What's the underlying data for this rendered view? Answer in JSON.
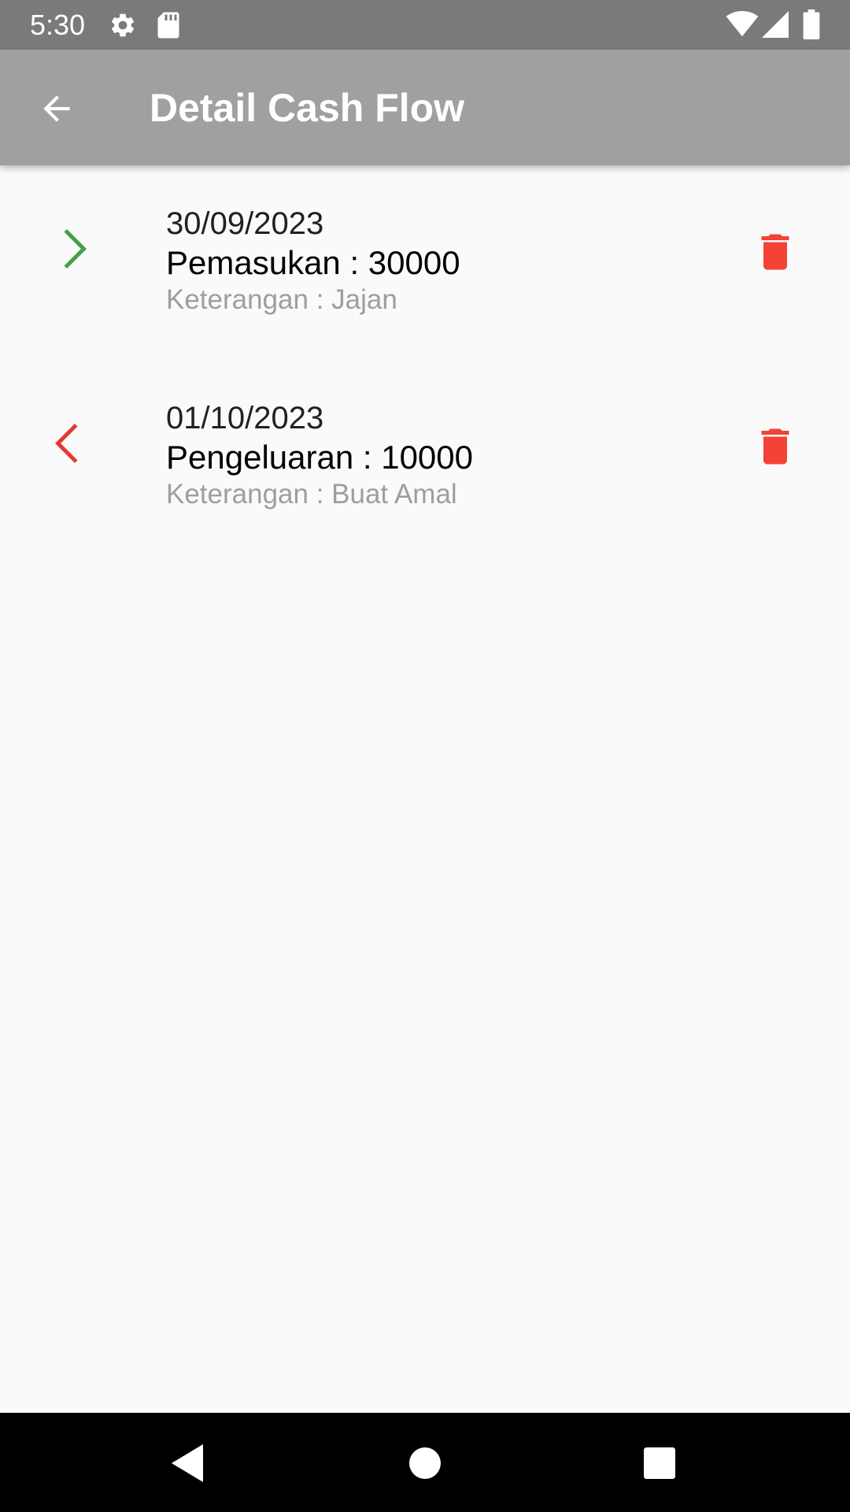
{
  "status_bar": {
    "time": "5:30",
    "icons": [
      "gear-icon",
      "sd-card-icon",
      "wifi-icon",
      "signal-icon",
      "battery-icon"
    ]
  },
  "app_bar": {
    "title": "Detail Cash Flow",
    "back_icon": "arrow-back-icon",
    "color": "#a0a0a0"
  },
  "transactions": [
    {
      "type": "income",
      "date": "30/09/2023",
      "amount_text": "Pemasukan : 30000",
      "note": "Keterangan : Jajan",
      "icon": "chevron-right-icon",
      "icon_color": "#43a047"
    },
    {
      "type": "expense",
      "date": "01/10/2023",
      "amount_text": "Pengeluaran : 10000",
      "note": "Keterangan : Buat Amal",
      "icon": "chevron-left-icon",
      "icon_color": "#e53935"
    }
  ],
  "delete_icon": "trash-icon",
  "delete_color": "#f44336",
  "nav_bar": {
    "buttons": [
      "nav-back-icon",
      "nav-home-icon",
      "nav-recents-icon"
    ]
  }
}
